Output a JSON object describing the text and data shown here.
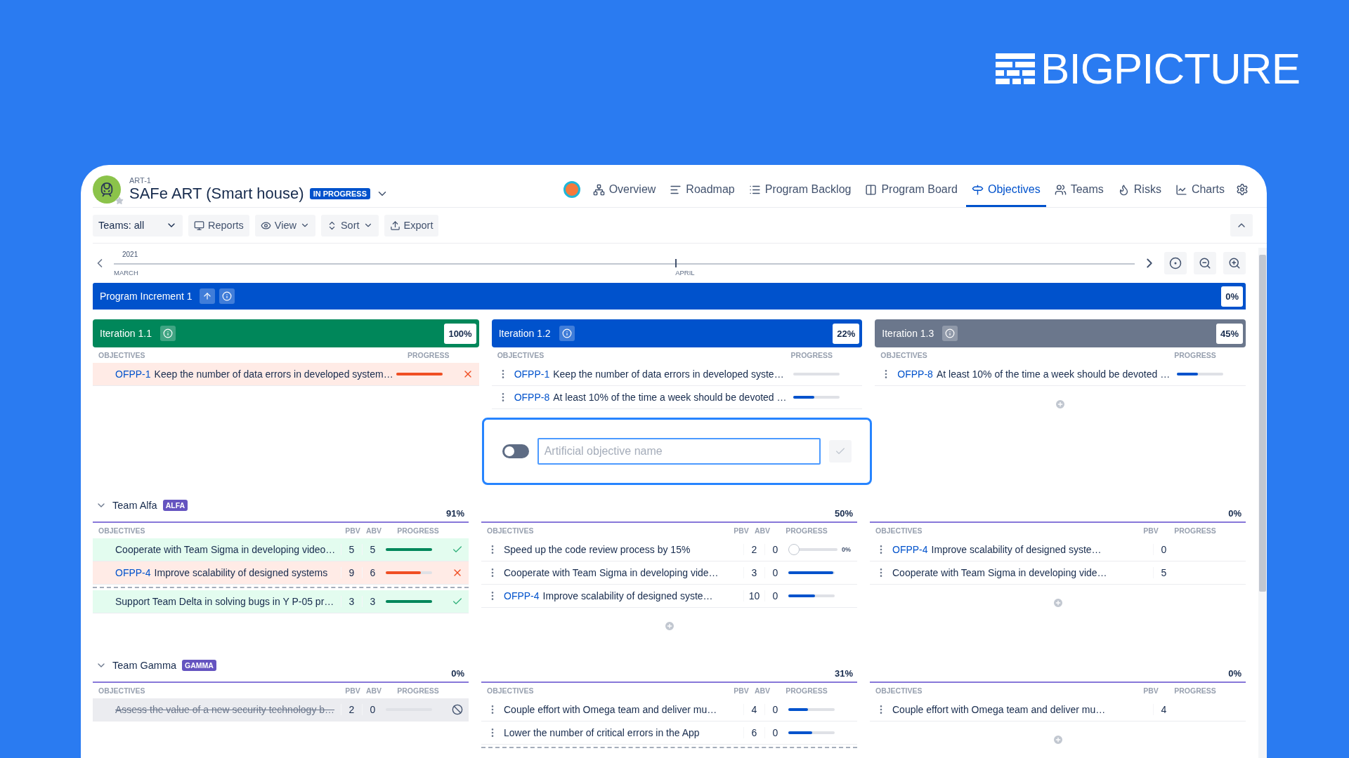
{
  "logo": {
    "text": "**BIG**PICTURE"
  },
  "header": {
    "key": "ART-1",
    "title": "SAFe ART (Smart house)",
    "status": "IN PROGRESS"
  },
  "nav": [
    {
      "label": "Overview",
      "selected": false
    },
    {
      "label": "Roadmap",
      "selected": false
    },
    {
      "label": "Program Backlog",
      "selected": false
    },
    {
      "label": "Program Board",
      "selected": false
    },
    {
      "label": "Objectives",
      "selected": true
    },
    {
      "label": "Teams",
      "selected": false
    },
    {
      "label": "Risks",
      "selected": false
    },
    {
      "label": "Charts",
      "selected": false
    }
  ],
  "toolbar": {
    "teams_filter": "Teams: all",
    "buttons": [
      {
        "label": "Reports",
        "dropdown": false
      },
      {
        "label": "View",
        "dropdown": true
      },
      {
        "label": "Sort",
        "dropdown": true
      },
      {
        "label": "Export",
        "dropdown": false
      }
    ]
  },
  "timeline": {
    "year": "2021",
    "months": [
      "MARCH",
      "APRIL"
    ]
  },
  "program_increment": {
    "title": "Program Increment 1",
    "progress": "0%"
  },
  "iterations": [
    {
      "title": "Iteration 1.1",
      "progress": "100%",
      "color": "#00875a",
      "headers": [
        "OBJECTIVES",
        "PROGRESS"
      ],
      "add_button": false,
      "objectives": [
        {
          "kind": "missed",
          "key": "OFPP-1",
          "title": "Keep the number of data errors in developed system…",
          "level": 1,
          "menu": false
        }
      ]
    },
    {
      "title": "Iteration 1.2",
      "progress": "22%",
      "color": "#0052cc",
      "headers": [
        "OBJECTIVES",
        "PROGRESS"
      ],
      "add_button": false,
      "objectives": [
        {
          "kind": "open",
          "key": "OFPP-1",
          "title": "Keep the number of data errors in developed syste…",
          "level": 0,
          "menu": true
        },
        {
          "kind": "open",
          "key": "OFPP-8",
          "title": "At least 10% of the time a week should be devoted …",
          "level": 0.45,
          "menu": true
        }
      ],
      "new_objective": {
        "placeholder": "Artificial objective name",
        "on": false
      }
    },
    {
      "title": "Iteration 1.3",
      "progress": "45%",
      "color": "#6b778c",
      "headers": [
        "OBJECTIVES",
        "PROGRESS"
      ],
      "add_button": true,
      "objectives": [
        {
          "kind": "open",
          "key": "OFPP-8",
          "title": "At least 10% of the time a week should be devoted …",
          "level": 0.45,
          "menu": true
        }
      ]
    }
  ],
  "teams": [
    {
      "name": "Team Alfa",
      "badge": "ALFA",
      "expanded": true,
      "columns": [
        {
          "progress": "91%",
          "headers": [
            "OBJECTIVES",
            "PBV",
            "ABV",
            "PROGRESS"
          ],
          "add_button": false,
          "objectives": [
            {
              "kind": "achieved",
              "title": "Cooperate with Team Sigma in developing video…",
              "pbv": "5",
              "abv": "5",
              "level": 1,
              "menu": false
            },
            {
              "kind": "missed",
              "key": "OFPP-4",
              "title": "Improve scalability of designed systems",
              "pbv": "9",
              "abv": "6",
              "level": 0.75,
              "menu": false
            },
            {
              "kind": "divider"
            },
            {
              "kind": "achieved",
              "title": "Support Team Delta in solving bugs in Y P-05 pr…",
              "pbv": "3",
              "abv": "3",
              "level": 1,
              "menu": false
            }
          ]
        },
        {
          "progress": "50%",
          "headers": [
            "OBJECTIVES",
            "PBV",
            "ABV",
            "PROGRESS"
          ],
          "add_button": true,
          "objectives": [
            {
              "kind": "open",
              "title": "Speed up the code review process by 15%",
              "pbv": "2",
              "abv": "0",
              "level": 0,
              "reading": "0%",
              "menu": true
            },
            {
              "kind": "open",
              "title": "Cooperate with Team Sigma in developing vide…",
              "pbv": "3",
              "abv": "0",
              "level": 0.97,
              "menu": true
            },
            {
              "kind": "open",
              "key": "OFPP-4",
              "title": "Improve scalability of designed syste…",
              "pbv": "10",
              "abv": "0",
              "level": 0.57,
              "menu": true
            }
          ]
        },
        {
          "progress": "0%",
          "headers": [
            "OBJECTIVES",
            "PBV",
            "PROGRESS"
          ],
          "add_button": true,
          "objectives": [
            {
              "kind": "open",
              "key": "OFPP-4",
              "title": "Improve scalability of designed syste…",
              "pbv": "0",
              "menu": true
            },
            {
              "kind": "open",
              "title": "Cooperate with Team Sigma in developing vide…",
              "pbv": "5",
              "menu": true
            }
          ]
        }
      ]
    },
    {
      "name": "Team Gamma",
      "badge": "GAMMA",
      "expanded": true,
      "columns": [
        {
          "progress": "0%",
          "headers": [
            "OBJECTIVES",
            "PBV",
            "ABV",
            "PROGRESS"
          ],
          "add_button": false,
          "objectives": [
            {
              "kind": "cancelled",
              "title": "Assess the value of a new security technology b…",
              "pbv": "2",
              "abv": "0",
              "level": 0,
              "menu": false
            }
          ]
        },
        {
          "progress": "31%",
          "headers": [
            "OBJECTIVES",
            "PBV",
            "ABV",
            "PROGRESS"
          ],
          "add_button": false,
          "objectives": [
            {
              "kind": "open",
              "title": "Couple effort with Omega team and deliver mu…",
              "pbv": "4",
              "abv": "0",
              "level": 0.43,
              "menu": true
            },
            {
              "kind": "open",
              "title": "Lower the number of critical errors in the App",
              "pbv": "6",
              "abv": "0",
              "level": 0.52,
              "menu": true
            },
            {
              "kind": "divider"
            }
          ]
        },
        {
          "progress": "0%",
          "headers": [
            "OBJECTIVES",
            "PBV",
            "PROGRESS"
          ],
          "add_button": true,
          "objectives": [
            {
              "kind": "open",
              "title": "Couple effort with Omega team and deliver mu…",
              "pbv": "4",
              "menu": true
            }
          ]
        }
      ]
    }
  ]
}
